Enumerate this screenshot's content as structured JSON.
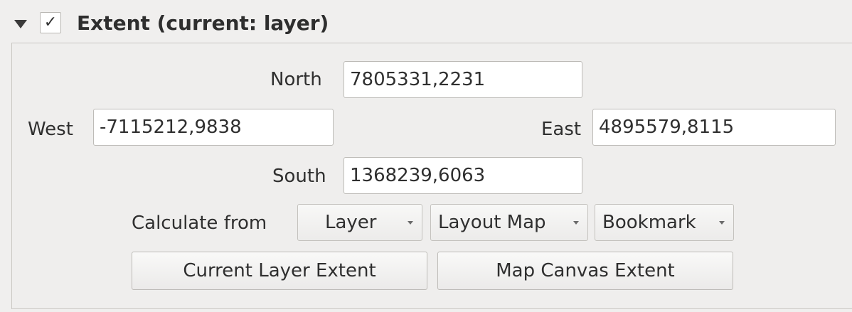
{
  "header": {
    "title": "Extent (current: layer)",
    "checked": true,
    "checkmark": "✓"
  },
  "extent": {
    "north": {
      "label": "North",
      "value": "7805331,2231"
    },
    "west": {
      "label": "West",
      "value": "-7115212,9838"
    },
    "east": {
      "label": "East",
      "value": "4895579,8115"
    },
    "south": {
      "label": "South",
      "value": "1368239,6063"
    }
  },
  "calculate": {
    "label": "Calculate from",
    "options": [
      {
        "label": "Layer"
      },
      {
        "label": "Layout Map"
      },
      {
        "label": "Bookmark"
      }
    ]
  },
  "buttons": {
    "current_layer_extent": "Current Layer Extent",
    "map_canvas_extent": "Map Canvas Extent"
  }
}
